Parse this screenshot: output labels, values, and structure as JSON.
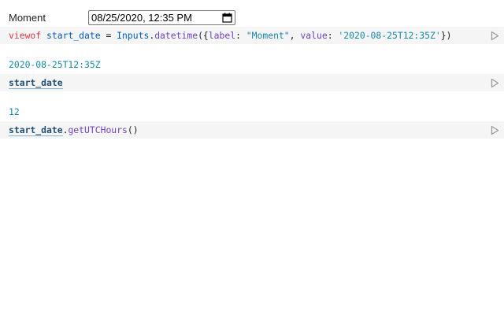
{
  "input_form": {
    "label": "Moment",
    "value": "08/25/2020, 12:35 PM"
  },
  "cells": [
    {
      "tokens": {
        "kw": "viewof",
        "name": "start_date",
        "op": " = ",
        "obj": "Inputs",
        "dot": ".",
        "method": "datetime",
        "open": "({",
        "key1": "label",
        "colon1": ": ",
        "val1": "\"Moment\"",
        "comma": ", ",
        "key2": "value",
        "colon2": ": ",
        "val2": "'2020-08-25T12:35Z'",
        "close": "})"
      }
    },
    {
      "output": "2020-08-25T12:35Z",
      "tokens": {
        "ref": "start_date"
      }
    },
    {
      "output": "12",
      "tokens": {
        "ref": "start_date",
        "dot": ".",
        "method": "getUTCHours",
        "parens": "()"
      }
    }
  ],
  "icons": {
    "run": "play-triangle-icon",
    "calendar": "calendar-icon"
  },
  "colors": {
    "cell_background": "#f5f5f5",
    "keyword": "#d73a49",
    "string": "#1887a6",
    "method": "#6f42c1",
    "output": "#1887a6"
  }
}
